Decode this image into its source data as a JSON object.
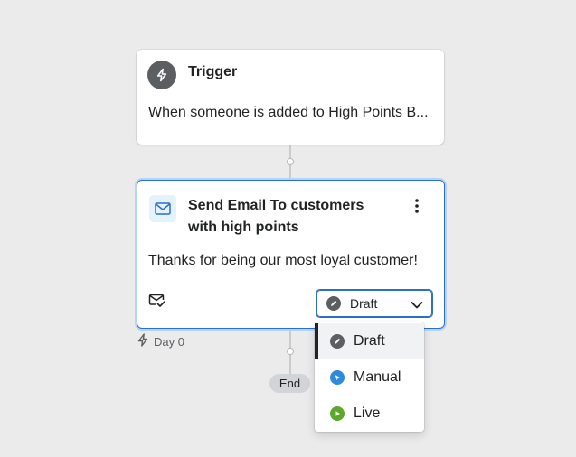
{
  "trigger": {
    "title": "Trigger",
    "description": "When someone is added to High Points B..."
  },
  "email_step": {
    "title_line1": "Send Email To customers",
    "title_line2": "with high points",
    "message": "Thanks for being our most loyal customer!",
    "status_value": "Draft"
  },
  "timeline": {
    "day_label": "Day 0",
    "end_label": "End"
  },
  "status_dropdown": {
    "options": [
      {
        "label": "Draft",
        "icon": "draft-icon",
        "color": "#5c5f62",
        "selected": true
      },
      {
        "label": "Manual",
        "icon": "manual-cursor-icon",
        "color": "#2c8be0",
        "selected": false
      },
      {
        "label": "Live",
        "icon": "live-play-icon",
        "color": "#5ba82a",
        "selected": false
      }
    ]
  },
  "colors": {
    "accent": "#2c6ecb",
    "background": "#ebebec"
  }
}
